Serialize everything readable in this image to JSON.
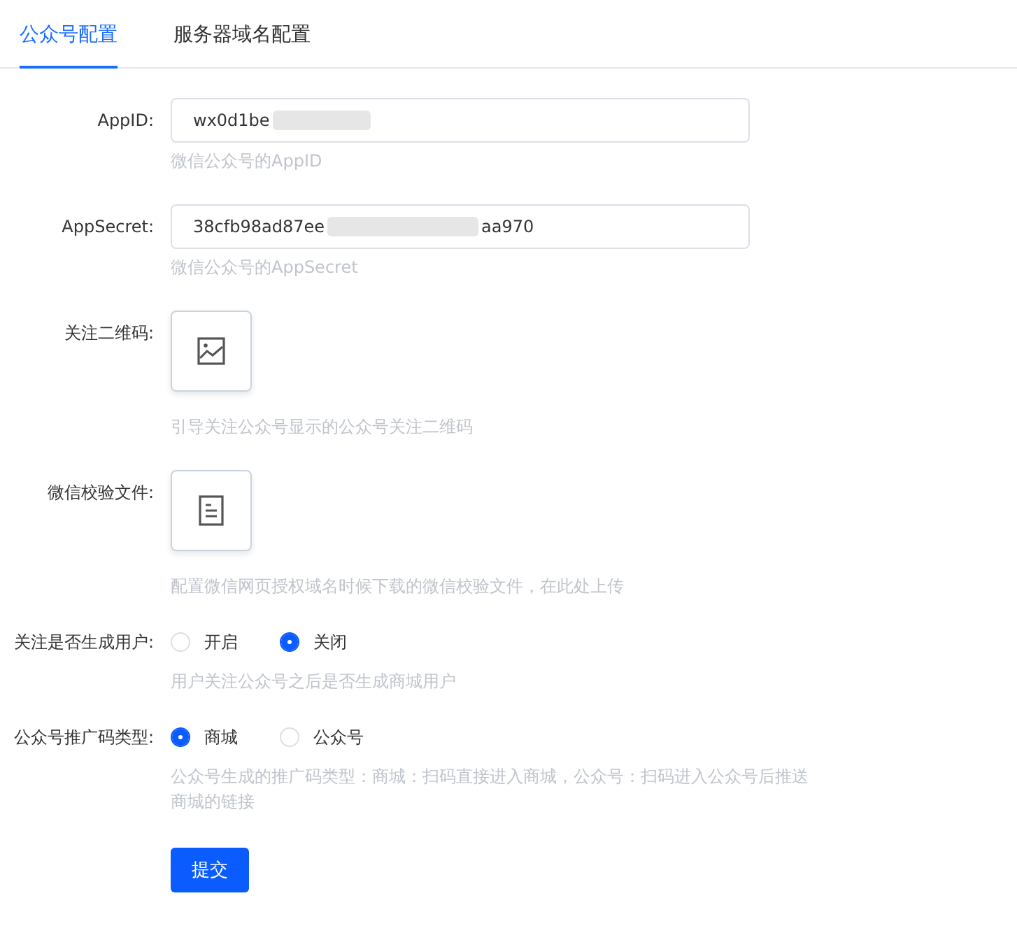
{
  "tabs": [
    {
      "label": "公众号配置",
      "selected": true
    },
    {
      "label": "服务器域名配置",
      "selected": false
    }
  ],
  "form": [
    {
      "kind": "text",
      "label": "AppID:",
      "value": "wx0d1be",
      "redacted": true,
      "hint": "微信公众号的AppID"
    },
    {
      "kind": "text",
      "label": "AppSecret:",
      "value": "38cfb98ad87ee",
      "redacted": true,
      "value_end": "aa970",
      "hint": "微信公众号的AppSecret"
    },
    {
      "kind": "image_upload",
      "label": "关注二维码:",
      "hint": "引导关注公众号显示的公众号关注二维码"
    },
    {
      "kind": "file_upload",
      "label": "微信校验文件:",
      "hint": "配置微信网页授权域名时候下载的微信校验文件，在此处上传"
    },
    {
      "kind": "radio",
      "label": "关注是否生成用户:",
      "options": [
        {
          "label": "开启",
          "selected": false
        },
        {
          "label": "关闭",
          "selected": true
        }
      ],
      "hint": "用户关注公众号之后是否生成商城用户"
    },
    {
      "kind": "radio",
      "label": "公众号推广码类型:",
      "options": [
        {
          "label": "商城",
          "selected": true
        },
        {
          "label": "公众号",
          "selected": false
        }
      ],
      "hint": "公众号生成的推广码类型：商城：扫码直接进入商城，公众号：扫码进入公众号后推送商城的链接"
    }
  ],
  "submit": "提交"
}
